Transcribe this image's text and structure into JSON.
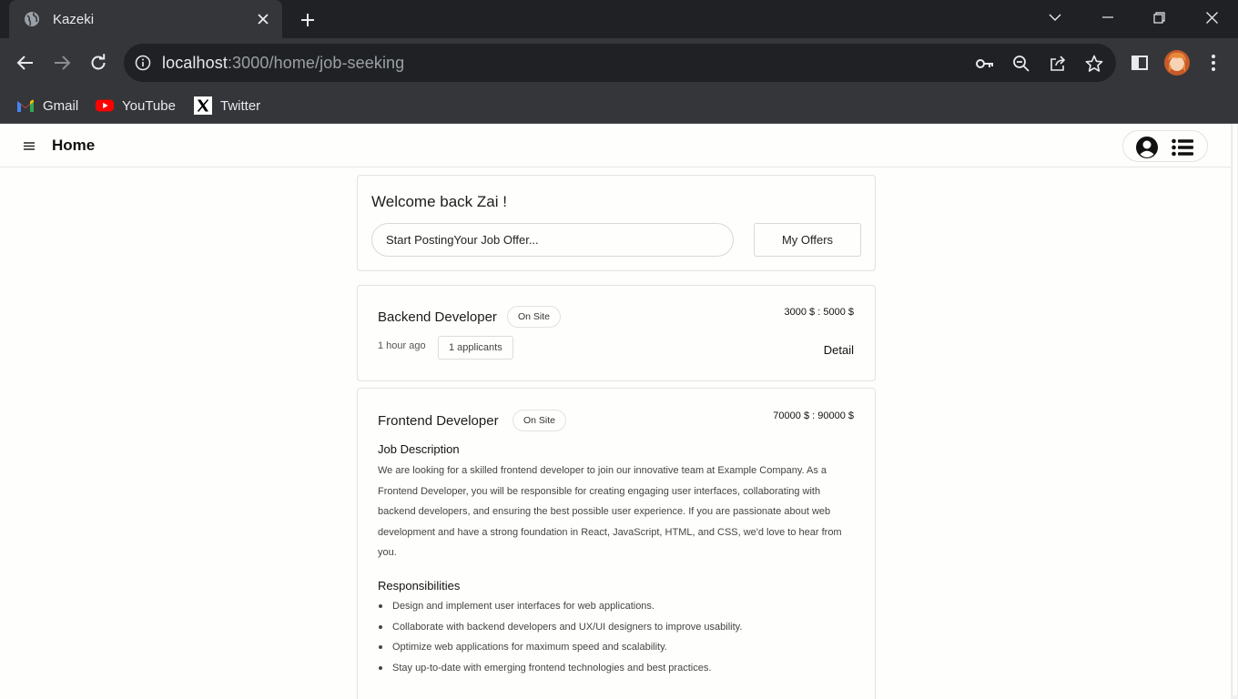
{
  "browser": {
    "tab_title": "Kazeki",
    "url_host": "localhost",
    "url_path": ":3000/home/job-seeking",
    "bookmarks": [
      {
        "label": "Gmail",
        "icon": "gmail-icon"
      },
      {
        "label": "YouTube",
        "icon": "youtube-icon"
      },
      {
        "label": "Twitter",
        "icon": "x-twitter-icon"
      }
    ]
  },
  "app": {
    "title": "Home"
  },
  "welcome": {
    "greeting": "Welcome back Zai !",
    "post_placeholder": "Start PostingYour Job Offer...",
    "my_offers_label": "My Offers"
  },
  "jobs": [
    {
      "title": "Backend Developer",
      "location_type": "On Site",
      "salary": "3000 $ : 5000 $",
      "posted": "1 hour ago",
      "applicants": "1 applicants",
      "detail_label": "Detail"
    },
    {
      "title": "Frontend Developer",
      "location_type": "On Site",
      "salary": "70000 $ : 90000 $",
      "description_heading": "Job Description",
      "description": "We are looking for a skilled frontend developer to join our innovative team at Example Company. As a Frontend Developer, you will be responsible for creating engaging user interfaces, collaborating with backend developers, and ensuring the best possible user experience. If you are passionate about web development and have a strong foundation in React, JavaScript, HTML, and CSS, we'd love to hear from you.",
      "responsibilities_heading": "Responsibilities",
      "responsibilities": [
        "Design and implement user interfaces for web applications.",
        "Collaborate with backend developers and UX/UI designers to improve usability.",
        "Optimize web applications for maximum speed and scalability.",
        "Stay up-to-date with emerging frontend technologies and best practices."
      ]
    }
  ],
  "colors": {
    "chrome_dark": "#202124",
    "chrome_toolbar": "#35363a",
    "page_bg": "#fefefc",
    "border": "#e2e2e2"
  }
}
